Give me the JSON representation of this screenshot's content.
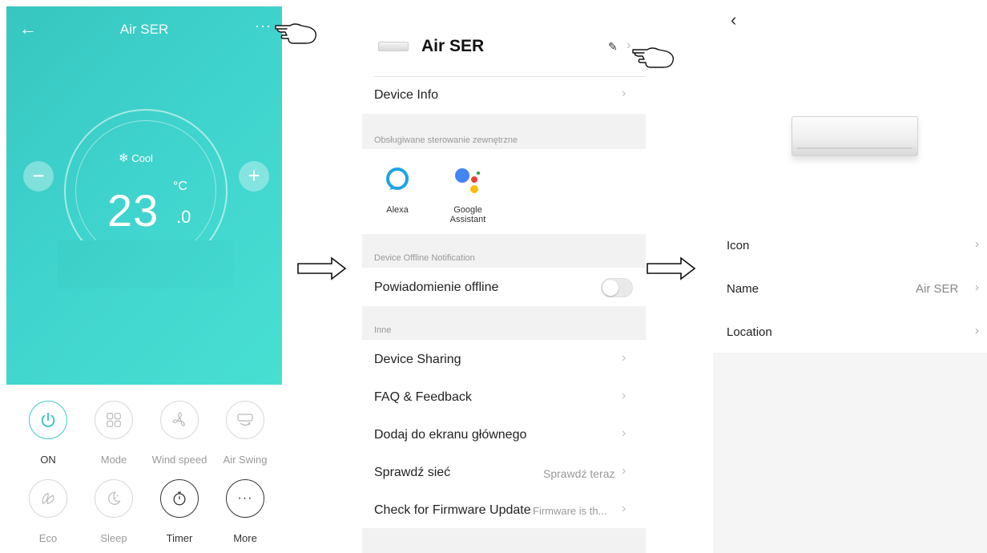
{
  "screen1": {
    "title": "Air SER",
    "back_icon": "back-arrow-icon",
    "more_label": "···",
    "mode": "Cool",
    "temperature": "23",
    "temperature_decimal": ".0",
    "unit": "°C",
    "minus_label": "−",
    "plus_label": "+",
    "accent": "#3fc9c2",
    "controls_row1": [
      {
        "label": "ON",
        "icon": "power-icon"
      },
      {
        "label": "Mode",
        "icon": "mode-grid-icon"
      },
      {
        "label": "Wind speed",
        "icon": "fan-icon"
      },
      {
        "label": "Air Swing",
        "icon": "swing-icon"
      }
    ],
    "controls_row2": [
      {
        "label": "Eco",
        "icon": "leaf-icon"
      },
      {
        "label": "Sleep",
        "icon": "sleep-moon-icon"
      },
      {
        "label": "Timer",
        "icon": "timer-icon"
      },
      {
        "label": "More",
        "icon": "more-dots-icon",
        "glyph": "···"
      }
    ]
  },
  "screen2": {
    "title": "Air SER",
    "device_info": "Device Info",
    "external_control_section": "Obsługiwane sterowanie zewnętrzne",
    "services": [
      {
        "label": "Alexa",
        "icon": "alexa-icon"
      },
      {
        "label": "Google\nAssistant",
        "icon": "google-assistant-icon"
      }
    ],
    "offline_section": "Device Offline Notification",
    "offline_label": "Powiadomienie offline",
    "offline_enabled": false,
    "other_section": "Inne",
    "rows": [
      {
        "label": "Device Sharing",
        "value": ""
      },
      {
        "label": "FAQ & Feedback",
        "value": ""
      },
      {
        "label": "Dodaj do ekranu głównego",
        "value": ""
      },
      {
        "label": "Sprawdź sieć",
        "value": "Sprawdź teraz"
      },
      {
        "label": "Check for Firmware Update",
        "value": "Firmware is th..."
      }
    ]
  },
  "screen3": {
    "rows": [
      {
        "label": "Icon",
        "value": ""
      },
      {
        "label": "Name",
        "value": "Air SER"
      },
      {
        "label": "Location",
        "value": ""
      }
    ]
  }
}
